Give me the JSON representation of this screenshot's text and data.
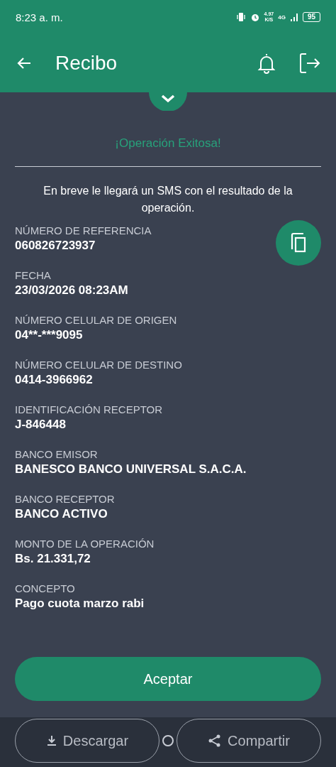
{
  "status_bar": {
    "time": "8:23 a. m.",
    "speed": "4.97",
    "speed_unit": "K/S",
    "network": "4G",
    "battery": "95"
  },
  "header": {
    "title": "Recibo"
  },
  "result": {
    "title": "¡Operación Exitosa!",
    "message": "En breve le llegará un SMS con el resultado de la operación."
  },
  "fields": [
    {
      "label": "NÚMERO DE REFERENCIA",
      "value": "060826723937"
    },
    {
      "label": "FECHA",
      "value": "23/03/2026 08:23AM"
    },
    {
      "label": "NÚMERO CELULAR DE ORIGEN",
      "value": "04**-***9095"
    },
    {
      "label": "NÚMERO CELULAR DE DESTINO",
      "value": "0414-3966962"
    },
    {
      "label": "IDENTIFICACIÓN RECEPTOR",
      "value": "J-846448"
    },
    {
      "label": "BANCO EMISOR",
      "value": "BANESCO BANCO UNIVERSAL S.A.C.A."
    },
    {
      "label": "BANCO RECEPTOR",
      "value": "BANCO ACTIVO"
    },
    {
      "label": "MONTO DE LA OPERACIÓN",
      "value": "Bs. 21.331,72"
    },
    {
      "label": "CONCEPTO",
      "value": "Pago cuota marzo rabi"
    }
  ],
  "buttons": {
    "accept": "Aceptar",
    "download": "Descargar",
    "share": "Compartir"
  }
}
